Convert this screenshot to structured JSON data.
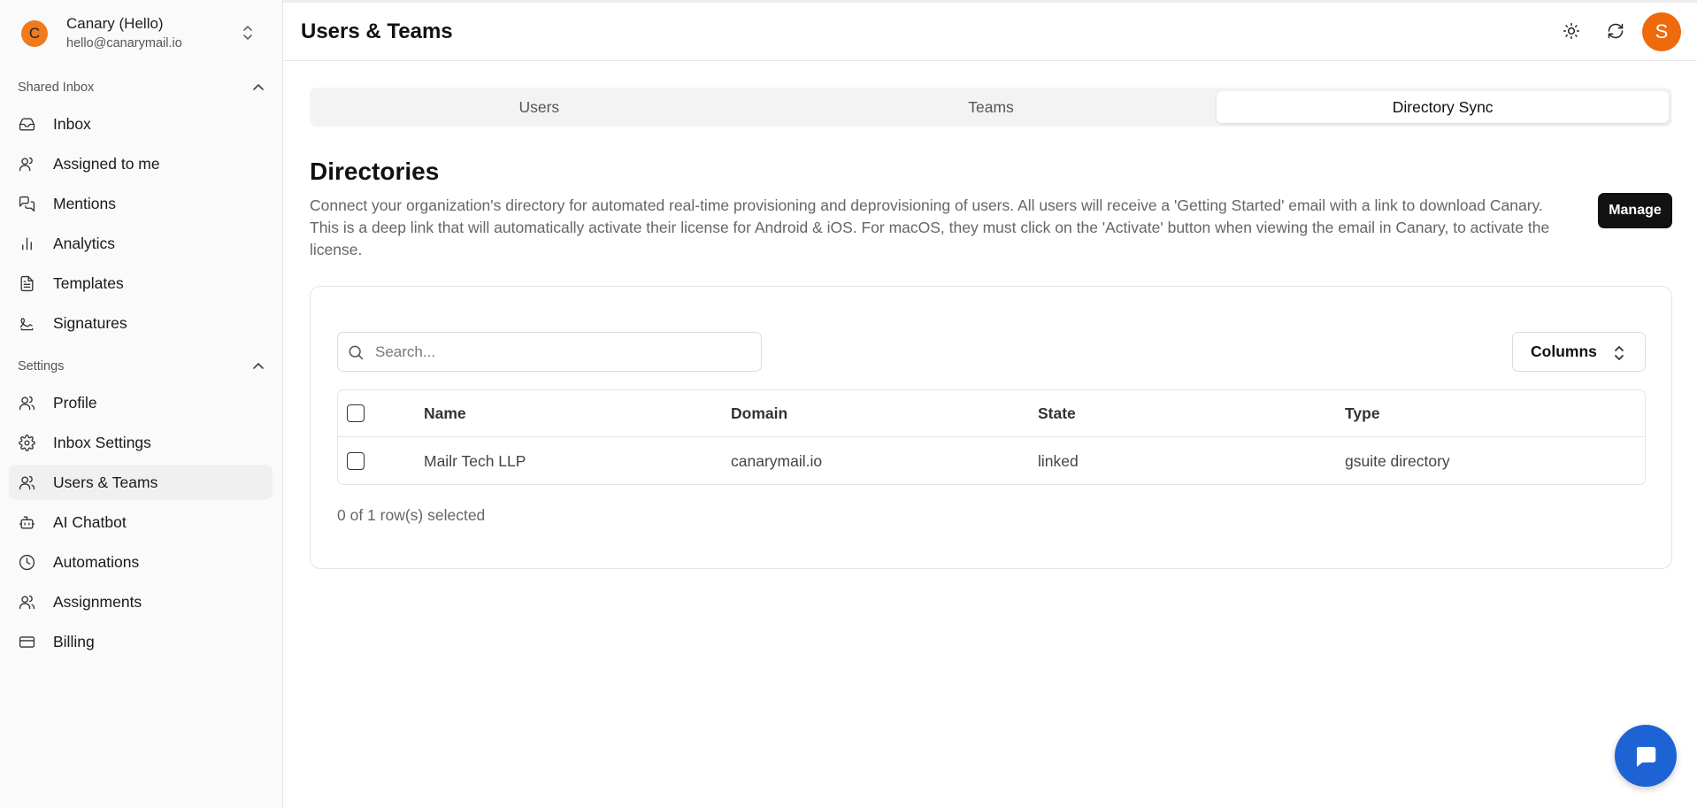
{
  "account": {
    "initial": "C",
    "name": "Canary (Hello)",
    "email": "hello@canarymail.io"
  },
  "sidebar": {
    "shared_inbox_label": "Shared Inbox",
    "shared_items": [
      {
        "label": "Inbox",
        "icon": "inbox-icon"
      },
      {
        "label": "Assigned to me",
        "icon": "user-icon"
      },
      {
        "label": "Mentions",
        "icon": "mentions-icon"
      },
      {
        "label": "Analytics",
        "icon": "bar-chart-icon"
      },
      {
        "label": "Templates",
        "icon": "document-icon"
      },
      {
        "label": "Signatures",
        "icon": "signature-icon"
      }
    ],
    "settings_label": "Settings",
    "settings_items": [
      {
        "label": "Profile",
        "icon": "users-icon"
      },
      {
        "label": "Inbox Settings",
        "icon": "gear-icon"
      },
      {
        "label": "Users & Teams",
        "icon": "users-icon",
        "active": true
      },
      {
        "label": "AI Chatbot",
        "icon": "bot-icon"
      },
      {
        "label": "Automations",
        "icon": "clock-icon"
      },
      {
        "label": "Assignments",
        "icon": "users-icon"
      },
      {
        "label": "Billing",
        "icon": "credit-card-icon"
      }
    ]
  },
  "header": {
    "title": "Users & Teams",
    "user_initial": "S"
  },
  "tabs": [
    {
      "label": "Users"
    },
    {
      "label": "Teams"
    },
    {
      "label": "Directory Sync",
      "active": true
    }
  ],
  "directories": {
    "title": "Directories",
    "description": "Connect your organization's directory for automated real-time provisioning and deprovisioning of users. All users will receive a 'Getting Started' email with a link to download Canary. This is a deep link that will automatically activate their license for Android & iOS. For macOS, they must click on the 'Activate' button when viewing the email in Canary, to activate the license.",
    "manage_label": "Manage"
  },
  "table": {
    "search_placeholder": "Search...",
    "columns_label": "Columns",
    "headers": [
      "Name",
      "Domain",
      "State",
      "Type"
    ],
    "rows": [
      [
        "Mailr Tech LLP",
        "canarymail.io",
        "linked",
        "gsuite directory"
      ]
    ],
    "selected_text": "0 of 1 row(s) selected"
  },
  "colors": {
    "accent_orange": "#ee6a0c",
    "chat_blue": "#1e63d4",
    "primary_button": "#121212"
  }
}
